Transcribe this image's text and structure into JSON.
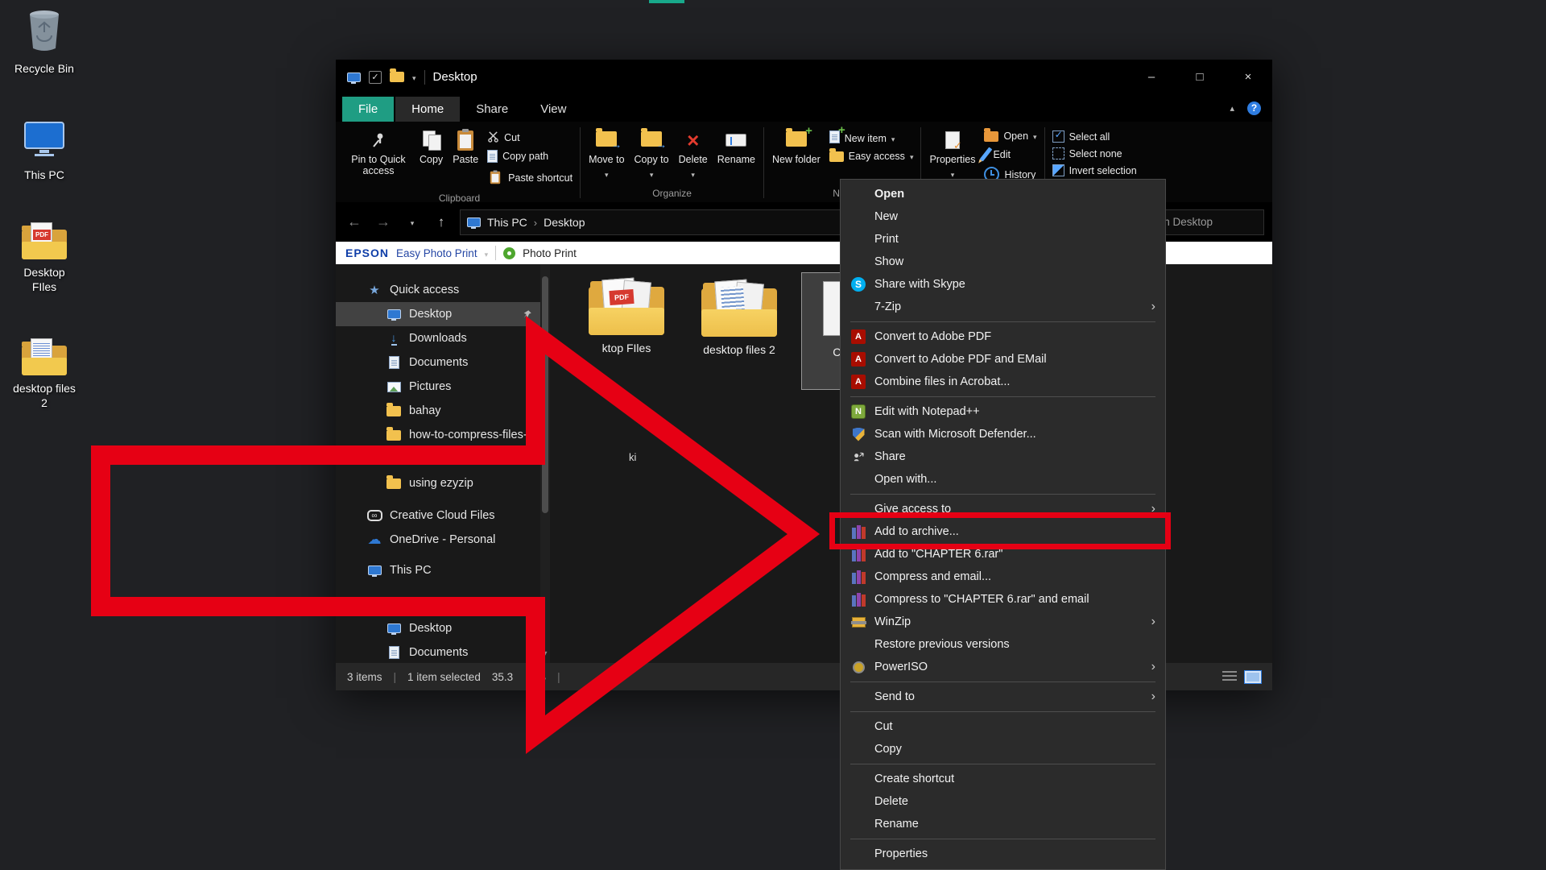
{
  "annotations": {
    "arrow_color": "#e60014",
    "highlight_color": "#e60014"
  },
  "desktop": {
    "icons": [
      {
        "label": "Recycle Bin"
      },
      {
        "label": "This PC"
      },
      {
        "label": "Desktop FIles"
      },
      {
        "label": "desktop files 2"
      }
    ]
  },
  "titlebar": {
    "title": "Desktop",
    "minimize": "–",
    "maximize": "□",
    "close": "×"
  },
  "tabs": {
    "file": "File",
    "home": "Home",
    "share": "Share",
    "view": "View",
    "help": "?"
  },
  "ribbon": {
    "pin_to_quick_access": "Pin to Quick access",
    "copy": "Copy",
    "paste": "Paste",
    "cut": "Cut",
    "copy_path": "Copy path",
    "paste_shortcut": "Paste shortcut",
    "clipboard_group": "Clipboard",
    "move_to": "Move to",
    "copy_to": "Copy to",
    "delete": "Delete",
    "rename": "Rename",
    "organize_group": "Organize",
    "new_folder": "New folder",
    "new_item": "New item",
    "easy_access": "Easy access",
    "new_group": "New",
    "properties": "Properties",
    "open": "Open",
    "edit": "Edit",
    "history": "History",
    "select_all": "Select all",
    "select_none": "Select none",
    "invert_selection": "Invert selection"
  },
  "navbar": {
    "breadcrumb": [
      "This PC",
      "Desktop"
    ],
    "search": "Search Desktop"
  },
  "epson_bar": {
    "brand": "EPSON",
    "app": "Easy Photo Print",
    "photo_print": "Photo Print"
  },
  "sidebar": {
    "items": [
      {
        "label": "Quick access"
      },
      {
        "label": "Desktop"
      },
      {
        "label": "Downloads"
      },
      {
        "label": "Documents"
      },
      {
        "label": "Pictures"
      },
      {
        "label": "bahay"
      },
      {
        "label": "how-to-compress-files-l"
      },
      {
        "label": "using ezyzip"
      },
      {
        "label": "Creative Cloud Files"
      },
      {
        "label": "OneDrive - Personal"
      },
      {
        "label": "This PC"
      },
      {
        "label": "Desktop"
      },
      {
        "label": "Documents"
      }
    ]
  },
  "content": {
    "files": [
      {
        "label": "ktop FIles"
      },
      {
        "label": "desktop files 2"
      },
      {
        "label": "CHA"
      }
    ],
    "stray_text": "ki"
  },
  "statusbar": {
    "item_count": "3 items",
    "divider": "|",
    "selection": "1 item selected",
    "size_left": "35.3",
    "size_right": "B"
  },
  "context_menu": {
    "items": [
      {
        "label": "Open"
      },
      {
        "label": "New"
      },
      {
        "label": "Print"
      },
      {
        "label": "Show"
      },
      {
        "label": "Share with Skype"
      },
      {
        "label": "7-Zip"
      },
      {
        "label": "Convert to Adobe PDF"
      },
      {
        "label": "Convert to Adobe PDF and EMail"
      },
      {
        "label": "Combine files in Acrobat..."
      },
      {
        "label": "Edit with Notepad++"
      },
      {
        "label": "Scan with Microsoft Defender..."
      },
      {
        "label": "Share"
      },
      {
        "label": "Open with..."
      },
      {
        "label": "Give access to"
      },
      {
        "label": "Add to archive..."
      },
      {
        "label": "Add to \"CHAPTER 6.rar\""
      },
      {
        "label": "Compress and email..."
      },
      {
        "label": "Compress to \"CHAPTER 6.rar\" and email"
      },
      {
        "label": "WinZip"
      },
      {
        "label": "Restore previous versions"
      },
      {
        "label": "PowerISO"
      },
      {
        "label": "Send to"
      },
      {
        "label": "Cut"
      },
      {
        "label": "Copy"
      },
      {
        "label": "Create shortcut"
      },
      {
        "label": "Delete"
      },
      {
        "label": "Rename"
      },
      {
        "label": "Properties"
      }
    ]
  }
}
